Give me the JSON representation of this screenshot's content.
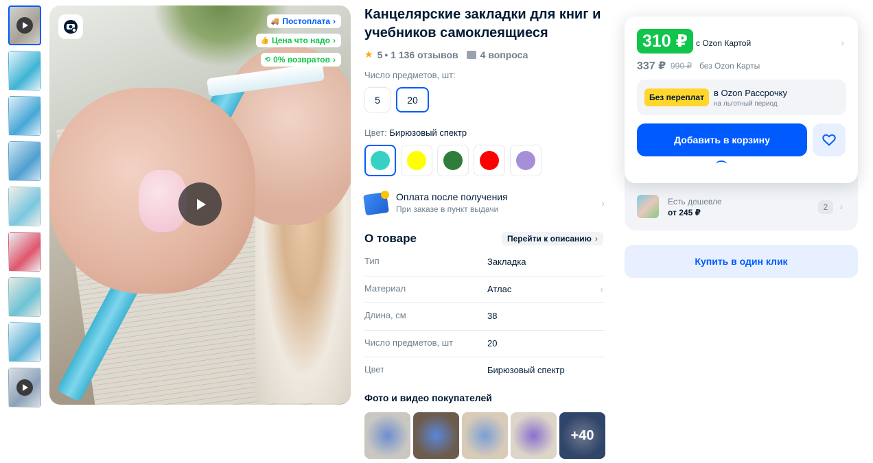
{
  "gallery": {
    "thumbnails": [
      {
        "type": "video",
        "colors": [
          "#cfd3cc",
          "#a9a096"
        ]
      },
      {
        "type": "image",
        "colors": [
          "#e8f2fb",
          "#3fb4d4"
        ]
      },
      {
        "type": "image",
        "colors": [
          "#e4eef4",
          "#46a7d8"
        ]
      },
      {
        "type": "image",
        "colors": [
          "#cfe6f1",
          "#4f9fd0"
        ]
      },
      {
        "type": "image",
        "colors": [
          "#f3efe6",
          "#7ac7df"
        ]
      },
      {
        "type": "image",
        "colors": [
          "#e6f3f5",
          "#e0566c"
        ]
      },
      {
        "type": "image",
        "colors": [
          "#ede9e0",
          "#6cc3d6"
        ]
      },
      {
        "type": "image",
        "colors": [
          "#eef3f6",
          "#5ab2d7"
        ]
      },
      {
        "type": "video",
        "colors": [
          "#d9dfe4",
          "#8ca2ba"
        ]
      }
    ]
  },
  "media": {
    "badges": [
      {
        "label": "Постоплата",
        "style": "blue",
        "icon": "truck-icon"
      },
      {
        "label": "Цена что надо",
        "style": "green",
        "icon": "thumbs-up-icon"
      },
      {
        "label": "0% возвратов",
        "style": "green",
        "icon": "return-icon"
      }
    ]
  },
  "product": {
    "title": "Канцелярские закладки для книг и учебников самоклеящиеся",
    "rating": "5",
    "reviews": "• 1 136 отзывов",
    "questions": "4 вопроса",
    "quantity_label": "Число предметов, шт:",
    "quantity_options": [
      "5",
      "20"
    ],
    "color_label": "Цвет:",
    "color_value": "Бирюзовый спектр",
    "colors": [
      "#36d1c4",
      "#ffff00",
      "#2f7d3b",
      "#ff0000",
      "#a58fd6"
    ],
    "payment_title": "Оплата после получения",
    "payment_subtitle": "При заказе в пункт выдачи",
    "about_title": "О товаре",
    "about_link": "Перейти к описанию",
    "specs": [
      {
        "key": "Тип",
        "value": "Закладка"
      },
      {
        "key": "Материал",
        "value": "Атлас"
      },
      {
        "key": "Длина, см",
        "value": "38"
      },
      {
        "key": "Число предметов, шт",
        "value": "20"
      },
      {
        "key": "Цвет",
        "value": "Бирюзовый спектр"
      }
    ],
    "customer_photos_title": "Фото и видео покупателей",
    "customer_photos": [
      {
        "colors": [
          "#c9c7c1",
          "#6d8fcf"
        ]
      },
      {
        "colors": [
          "#6d5c4d",
          "#5a86d9"
        ]
      },
      {
        "colors": [
          "#d8cbb8",
          "#7a9fd6"
        ]
      },
      {
        "colors": [
          "#dcd5c8",
          "#8a6fcf"
        ]
      },
      {
        "colors": [
          "#4b6aa3",
          "#a6b7d8"
        ]
      }
    ],
    "more_photos": "+40"
  },
  "buy": {
    "price": "310 ₽",
    "price_card_label": "с Ozon Картой",
    "price_regular": "337 ₽",
    "price_old": "990 ₽",
    "price_nocard_label": "без Ozon Карты",
    "installment_tag": "Без переплат",
    "installment_title": "в Ozon Рассрочку",
    "installment_sub": "на льготный период",
    "cart_button": "Добавить в корзину",
    "cheaper_label": "Есть дешевле",
    "cheaper_price": "от 245 ₽",
    "cheaper_count": "2",
    "one_click": "Купить в один клик"
  }
}
